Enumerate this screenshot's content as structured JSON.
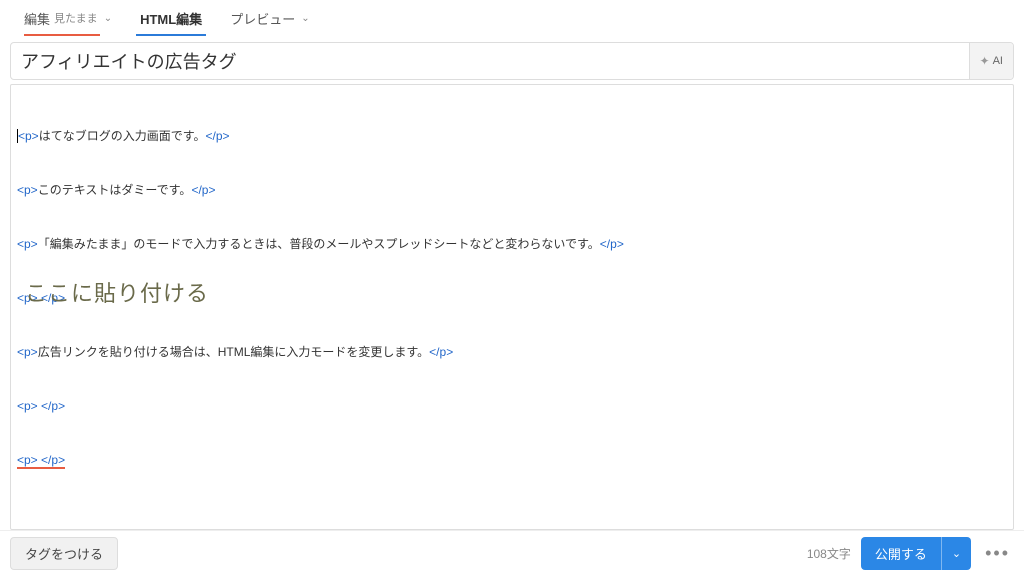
{
  "tabs": {
    "edit_label": "編集",
    "edit_sub": "見たまま",
    "html_edit_label": "HTML編集",
    "preview_label": "プレビュー"
  },
  "title": {
    "value": "アフィリエイトの広告タグ",
    "ai_label": "AI"
  },
  "code": {
    "lines": [
      {
        "text": "はてなブログの入力画面です。"
      },
      {
        "text": "このテキストはダミーです。"
      },
      {
        "text": "「編集みたまま」のモードで入力するときは、普段のメールやスプレッドシートなどと変わらないです。"
      },
      {
        "text": " "
      },
      {
        "text": "広告リンクを貼り付ける場合は、HTML編集に入力モードを変更します。"
      },
      {
        "text": " "
      },
      {
        "text": " "
      }
    ],
    "tag_open": "<p>",
    "tag_close": "</p>"
  },
  "annotation": "ここに貼り付ける",
  "bottom": {
    "tag_button": "タグをつける",
    "char_count": "108文字",
    "publish": "公開する"
  }
}
